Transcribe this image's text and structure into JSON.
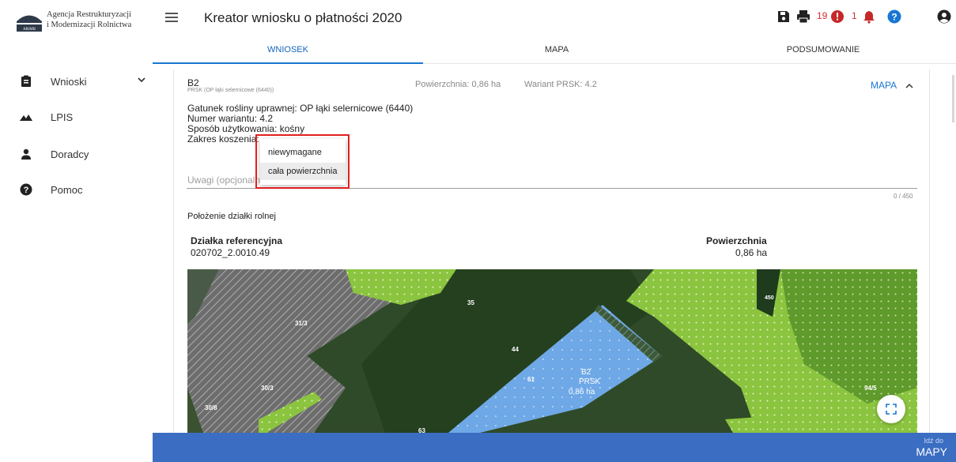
{
  "brand": {
    "line1": "Agencja Restrukturyzacji",
    "line2": "i Modernizacji Rolnictwa",
    "mark_text": "ARiMR"
  },
  "sidebar": {
    "items": [
      {
        "label": "Wnioski",
        "icon": "clipboard-icon"
      },
      {
        "label": "LPIS",
        "icon": "mountain-icon"
      },
      {
        "label": "Doradcy",
        "icon": "person-icon"
      },
      {
        "label": "Pomoc",
        "icon": "help-circle-icon"
      }
    ]
  },
  "header": {
    "title": "Kreator wniosku o płatności 2020",
    "errors_count": "19",
    "notifications_count": "1"
  },
  "tabs": [
    {
      "label": "WNIOSEK",
      "active": true
    },
    {
      "label": "MAPA",
      "active": false
    },
    {
      "label": "PODSUMOWANIE",
      "active": false
    }
  ],
  "parcel": {
    "code": "B2",
    "subtitle": "PRSK (OP łąki selernicowe (6440))",
    "area": "Powierzchnia: 0,86 ha",
    "variant": "Wariant PRSK: 4.2",
    "map_link": "MAPA",
    "details": [
      "Gatunek rośliny uprawnej: OP łąki selernicowe (6440)",
      "Numer wariantu: 4.2",
      "Sposób użytkowania: kośny",
      "Zakres koszenia:"
    ],
    "notes_placeholder": "Uwagi (opcjonalnie)",
    "notes_counter": "0 / 450"
  },
  "dropdown": {
    "options": [
      "niewymagane",
      "cała powierzchnia"
    ],
    "highlighted": "cała powierzchnia"
  },
  "location": {
    "heading": "Położenie działki rolnej",
    "ref_label": "Działka referencyjna",
    "ref_value": "020702_2.0010.49",
    "area_label": "Powierzchnia",
    "area_value": "0,86 ha"
  },
  "map": {
    "labels": [
      "35",
      "31/3",
      "44",
      "61",
      "30/3",
      "30/8",
      "94/5",
      "63",
      "450"
    ],
    "parcel_label": [
      "B2",
      "PRSK",
      "0,86 ha"
    ]
  },
  "bottom_bar": {
    "line1": "Idź do",
    "line2": "MAPY"
  },
  "colors": {
    "accent": "#1976d2",
    "bottom_bar": "#3b6ec2",
    "highlight": "#e02020",
    "error": "#d32f2f"
  }
}
